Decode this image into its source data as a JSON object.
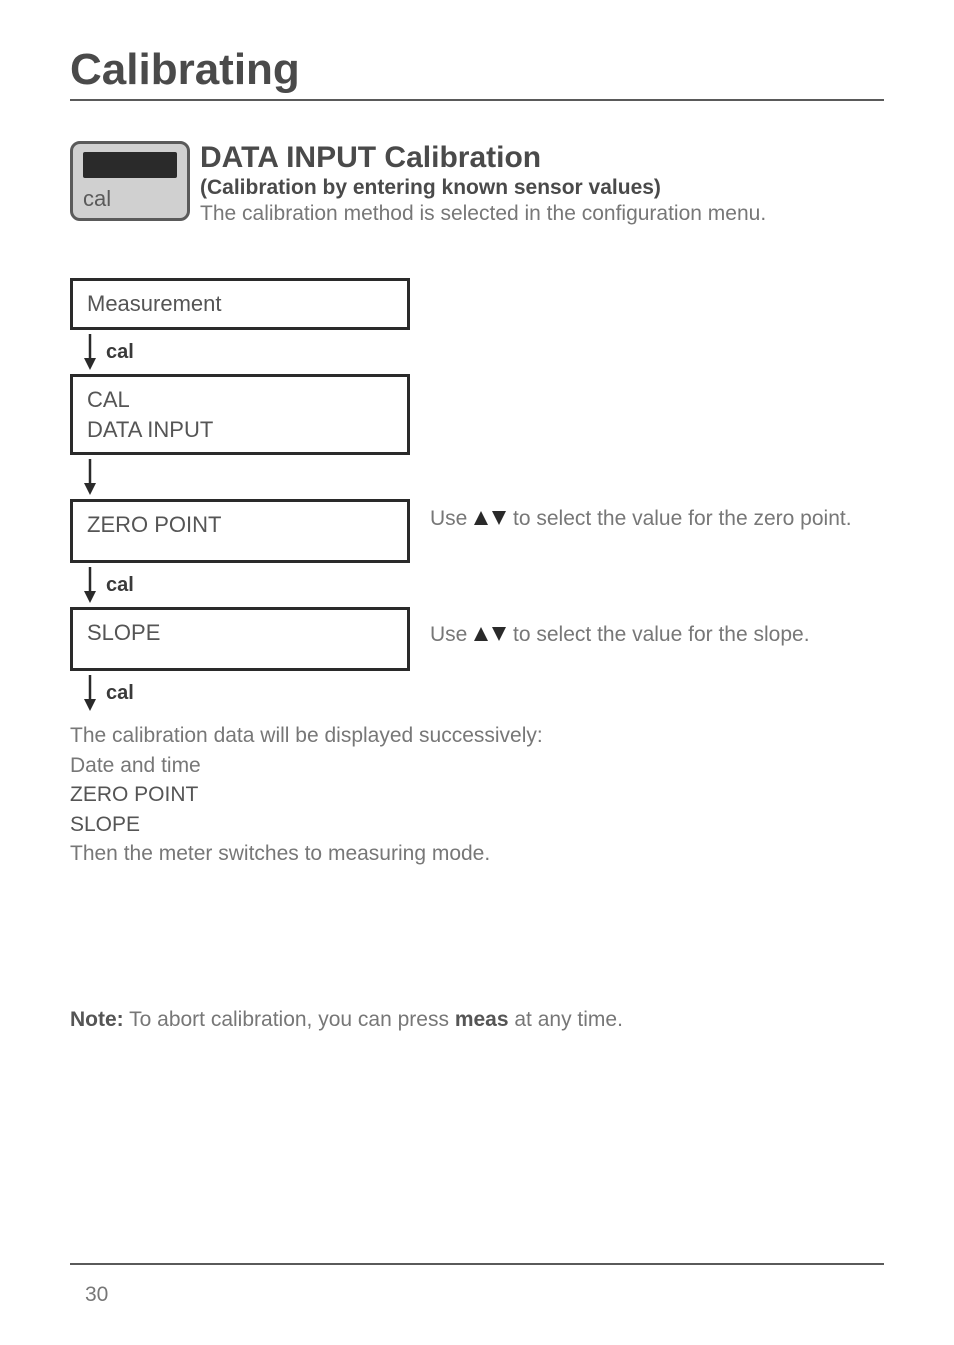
{
  "page": {
    "title": "Calibrating",
    "number": "30"
  },
  "device_icon": {
    "label": "cal"
  },
  "header": {
    "heading": "DATA INPUT Calibration",
    "subheading": "(Calibration by entering known sensor values)",
    "body": "The calibration method is selected in the configuration menu."
  },
  "flow": {
    "step_measurement": "Measurement",
    "arrow_a": "cal",
    "step_cal_datainput_line1": "CAL",
    "step_cal_datainput_line2": "DATA INPUT",
    "step_zero_point": "ZERO POINT",
    "desc_zero_point_pre": "Use ",
    "desc_zero_point_post": " to select the value for the zero point.",
    "arrow_b": "cal",
    "step_slope": "SLOPE",
    "desc_slope_pre": "Use ",
    "desc_slope_post": " to select the value for the slope.",
    "arrow_c": "cal"
  },
  "summary": {
    "line1": "The calibration data will be displayed successively:",
    "line2": "Date and time",
    "line3": "ZERO POINT",
    "line4": "SLOPE",
    "line5": "Then the meter switches to measuring mode."
  },
  "note": {
    "label": "Note:",
    "pre": " To abort calibration, you can press ",
    "key": "meas",
    "post": " at any time."
  },
  "icons": {
    "down_arrow": "down-arrow",
    "up_down_triangles": "up-down-triangles"
  }
}
